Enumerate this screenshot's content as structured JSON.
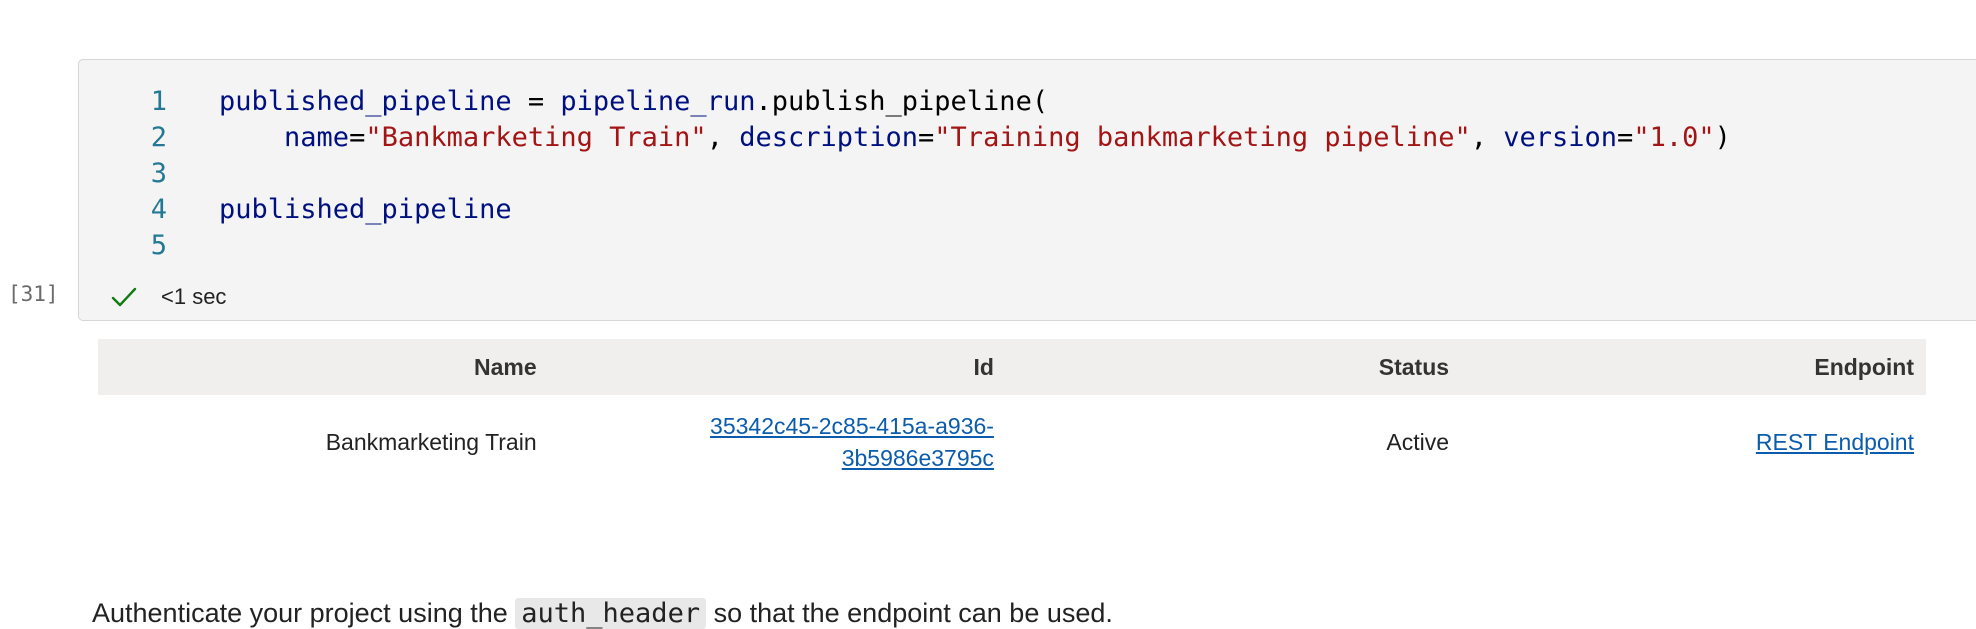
{
  "cell": {
    "execution_count": "[31]",
    "duration": "<1 sec",
    "line_numbers": [
      "1",
      "2",
      "3",
      "4",
      "5"
    ],
    "code": {
      "line1": {
        "var": "published_pipeline",
        "eq": " = ",
        "obj": "pipeline_run",
        "dot": ".",
        "method": "publish_pipeline",
        "paren": "("
      },
      "line2": {
        "indent": "    ",
        "k1": "name",
        "eq1": "=",
        "v1": "\"Bankmarketing Train\"",
        "sep1": ", ",
        "k2": "description",
        "eq2": "=",
        "v2": "\"Training bankmarketing pipeline\"",
        "sep2": ", ",
        "k3": "version",
        "eq3": "=",
        "v3": "\"1.0\"",
        "close": ")"
      },
      "line4": {
        "var": "published_pipeline"
      }
    }
  },
  "output_table": {
    "headers": [
      "Name",
      "Id",
      "Status",
      "Endpoint"
    ],
    "row": {
      "name": "Bankmarketing Train",
      "id_line1": "35342c45-2c85-415a-a936-",
      "id_line2": "3b5986e3795c",
      "status": "Active",
      "endpoint": "REST Endpoint"
    }
  },
  "below_text": {
    "before": "Authenticate your project using the ",
    "code": "auth_header",
    "after": " so that the endpoint can be used."
  },
  "colors": {
    "check": "#107c10",
    "link": "#0b5cad",
    "string": "#a31515",
    "variable": "#001080",
    "line_number": "#237893"
  },
  "icons": {
    "status": "check-icon"
  }
}
